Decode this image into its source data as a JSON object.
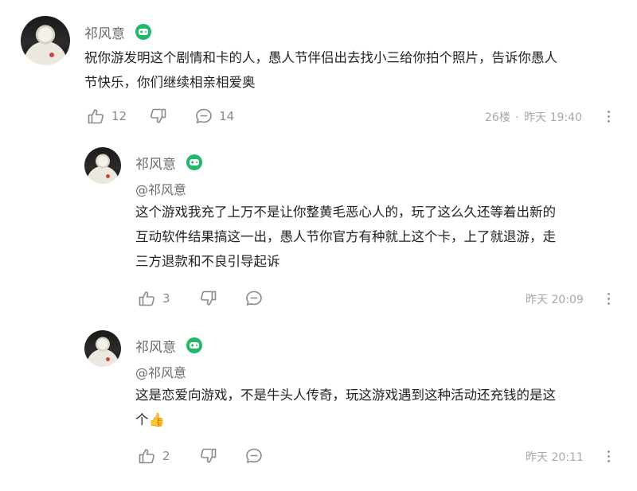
{
  "colors": {
    "badge": "#22b86a",
    "muted": "#8a8a8a",
    "text": "#222222"
  },
  "comments": [
    {
      "username": "祁风意",
      "badge_icon": "gamepad-icon",
      "mention": "",
      "lines": [
        "祝你游发明这个剧情和卡的人，愚人节伴侣出去找小三给你拍个照片，告诉你愚人",
        "节快乐，你们继续相亲相爱奥"
      ],
      "likes": "12",
      "replies": "14",
      "floor": "26楼",
      "separator": "·",
      "time": "昨天 19:40"
    },
    {
      "username": "祁风意",
      "badge_icon": "gamepad-icon",
      "mention": "@祁风意",
      "lines": [
        "这个游戏我充了上万不是让你整黄毛恶心人的，玩了这么久还等着出新的",
        "互动软件结果搞这一出，愚人节你官方有种就上这个卡，上了就退游，走",
        "三方退款和不良引导起诉"
      ],
      "likes": "3",
      "replies": "",
      "time": "昨天 20:09"
    },
    {
      "username": "祁风意",
      "badge_icon": "gamepad-icon",
      "mention": "@祁风意",
      "lines": [
        "这是恋爱向游戏，不是牛头人传奇，玩这游戏遇到这种活动还充钱的是这",
        "个👍"
      ],
      "likes": "2",
      "replies": "",
      "time": "昨天 20:11"
    }
  ]
}
